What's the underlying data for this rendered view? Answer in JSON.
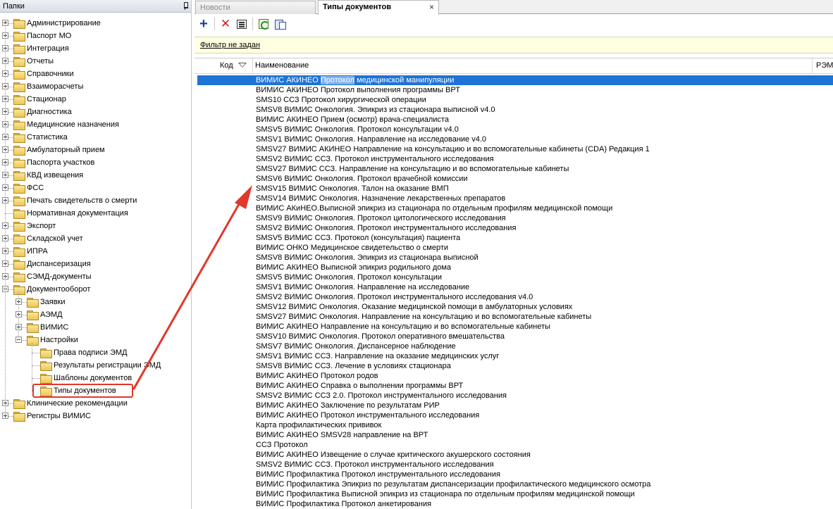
{
  "left_panel": {
    "title": "Папки",
    "tree": [
      {
        "label": "Администрирование",
        "level": 0,
        "state": "collapsed"
      },
      {
        "label": "Паспорт МО",
        "level": 0,
        "state": "collapsed"
      },
      {
        "label": "Интеграция",
        "level": 0,
        "state": "collapsed"
      },
      {
        "label": "Отчеты",
        "level": 0,
        "state": "collapsed"
      },
      {
        "label": "Справочники",
        "level": 0,
        "state": "collapsed"
      },
      {
        "label": "Взаиморасчеты",
        "level": 0,
        "state": "collapsed"
      },
      {
        "label": "Стационар",
        "level": 0,
        "state": "collapsed"
      },
      {
        "label": "Диагностика",
        "level": 0,
        "state": "collapsed"
      },
      {
        "label": "Медицинские назначения",
        "level": 0,
        "state": "collapsed"
      },
      {
        "label": "Статистика",
        "level": 0,
        "state": "collapsed"
      },
      {
        "label": "Амбулаторный прием",
        "level": 0,
        "state": "collapsed"
      },
      {
        "label": "Паспорта участков",
        "level": 0,
        "state": "collapsed"
      },
      {
        "label": "КВД извещения",
        "level": 0,
        "state": "collapsed"
      },
      {
        "label": "ФСС",
        "level": 0,
        "state": "collapsed"
      },
      {
        "label": "Печать свидетельств о смерти",
        "level": 0,
        "state": "collapsed"
      },
      {
        "label": "Нормативная документация",
        "level": 0,
        "state": "leaf"
      },
      {
        "label": "Экспорт",
        "level": 0,
        "state": "collapsed"
      },
      {
        "label": "Складской учет",
        "level": 0,
        "state": "collapsed"
      },
      {
        "label": "ИПРА",
        "level": 0,
        "state": "collapsed"
      },
      {
        "label": "Диспансеризация",
        "level": 0,
        "state": "collapsed"
      },
      {
        "label": "СЭМД-документы",
        "level": 0,
        "state": "collapsed"
      },
      {
        "label": "Документооборот",
        "level": 0,
        "state": "expanded"
      },
      {
        "label": "Заявки",
        "level": 1,
        "state": "collapsed"
      },
      {
        "label": "АЭМД",
        "level": 1,
        "state": "collapsed"
      },
      {
        "label": "ВИМИС",
        "level": 1,
        "state": "collapsed"
      },
      {
        "label": "Настройки",
        "level": 1,
        "state": "expanded"
      },
      {
        "label": "Права подписи ЭМД",
        "level": 2,
        "state": "leaf"
      },
      {
        "label": "Результаты регистрации ЭМД",
        "level": 2,
        "state": "leaf"
      },
      {
        "label": "Шаблоны документов",
        "level": 2,
        "state": "leaf"
      },
      {
        "label": "Типы документов",
        "level": 2,
        "state": "leaf",
        "selected": true
      },
      {
        "label": "Клинические рекомендации",
        "level": 0,
        "state": "collapsed"
      },
      {
        "label": "Регистры ВИМИС",
        "level": 0,
        "state": "collapsed"
      }
    ]
  },
  "tabs": [
    {
      "label": "Новости",
      "active": false
    },
    {
      "label": "Типы документов",
      "active": true,
      "close": "×"
    }
  ],
  "toolbar": {
    "add": "+",
    "delete": "✕"
  },
  "filter": {
    "label": "Фильтр не задан"
  },
  "grid": {
    "columns": {
      "code": "Код",
      "name": "Наименование",
      "rem": "РЭМ"
    },
    "selected_row": {
      "before": "ВИМИС АКИНЕО ",
      "highlight": "Протокол",
      "after": " медицинской манипуляции"
    },
    "rows": [
      "ВИМИС АКИНЕО Протокол выполнения программы ВРТ",
      "SMS10 ССЗ Протокол хирургической операции",
      "SMSV8 ВИМИС Онкология. Эпикриз из стационара выписной v4.0",
      "ВИМИС АКИНЕО Прием (осмотр) врача-специалиста",
      "SMSV5 ВИМИС Онкология. Протокол консультации v4.0",
      "SMSV1 ВИМИС Онкология. Направление на исследование v4.0",
      "SMSV27 ВИМИС АКИНЕО Направление на консультацию и во вспомогательные кабинеты (CDA) Редакция 1",
      "SMSV2 ВИМИС ССЗ. Протокол инструментального исследования",
      "SMSV27 ВИМИС ССЗ. Направление на консультацию и во вспомогательные кабинеты",
      "SMSV6 ВИМИС Онкология. Протокол врачебной комиссии",
      "SMSV15 ВИМИС Онкология. Талон на оказание ВМП",
      "SMSV14 ВИМИС Онкология. Назначение лекарственных препаратов",
      "ВИМИС АКиНЕО.Выписной эпикриз из стационара по отдельным профилям медицинской помощи",
      "SMSV9 ВИМИС Онкология. Протокол цитологического исследования",
      "SMSV2 ВИМИС Онкология. Протокол инструментального исследования",
      "SMSV5 ВИМИС ССЗ. Протокол (консультация) пациента",
      "ВИМИС ОНКО Медицинское свидетельство о смерти",
      "SMSV8 ВИМИС Онкология. Эпикриз из стационара выписной",
      "ВИМИС АКИНЕО Выписной эпикриз родильного дома",
      "SMSV5 ВИМИС Онкология. Протокол консультации",
      "SMSV1 ВИМИС Онкология. Направление на исследование",
      "SMSV2 ВИМИС Онкология. Протокол инструментального исследования v4.0",
      "SMSV12 ВИМИС Онкология. Оказание медицинской помощи в амбулаторных условиях",
      "SMSV27 ВИМИС Онкология. Направление на консультацию и во вспомогательные кабинеты",
      "ВИМИС АКИНЕО Направление на консультацию и во вспомогательные кабинеты",
      "SMSV10 ВИМИС Онкология. Протокол оперативного вмешательства",
      "SMSV7 ВИМИС Онкология. Диспансерное наблюдение",
      "SMSV1 ВИМИС ССЗ. Направление на оказание медицинских услуг",
      "SMSV8 ВИМИС ССЗ. Лечение в условиях стационара",
      "ВИМИС АКИНЕО Протокол родов",
      "ВИМИС АКИНЕО Справка о выполнении программы ВРТ",
      "SMSV2 ВИМИС ССЗ 2.0. Протокол инструментального исследования",
      "ВИМИС АКИНЕО Заключение по результатам РИР",
      "ВИМИС АКИНЕО Протокол инструментального исследования",
      "Карта профилактических прививок",
      "ВИМИС АКИНЕО SMSV28 направление на ВРТ",
      "ССЗ Протокол",
      "ВИМИС АКИНЕО Извещение о случае критического акушерского состояния",
      "SMSV2 ВИМИС ССЗ. Протокол инструментального исследования",
      "ВИМИС Профилактика Протокол инструментального исследования",
      "ВИМИС Профилактика Эпикриз по результатам диспансеризации профилактического медицинского осмотра",
      "ВИМИС Профилактика Выписной эпикриз из стационара по отдельным профилям медицинской помощи",
      "ВИМИС Профилактика Протокол анкетирования"
    ]
  },
  "colors": {
    "selection": "#1e73d6",
    "annotation": "#e2372b",
    "filter_bg": "#ffffe1",
    "folder": "#eec652"
  }
}
